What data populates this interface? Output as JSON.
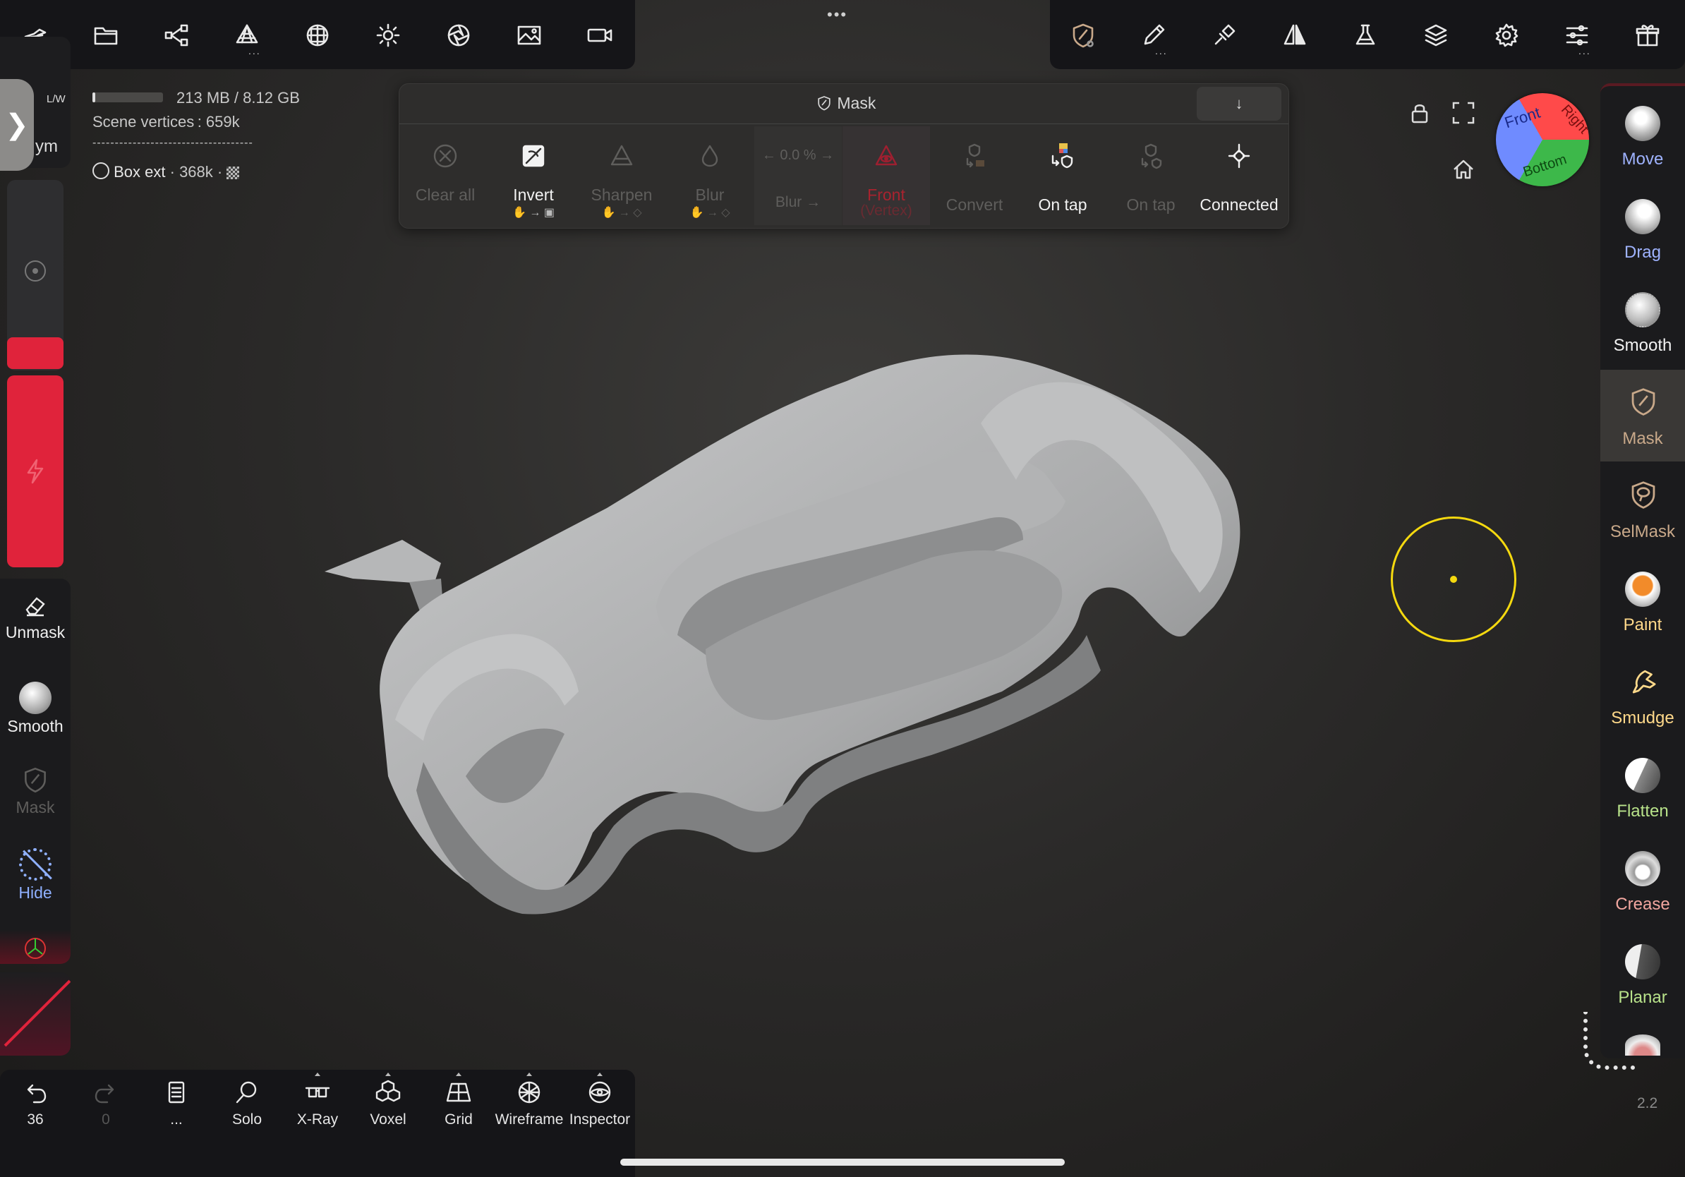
{
  "top_toolbar_left": {
    "icons": [
      "plane-icon",
      "folder-icon",
      "scene-graph-icon",
      "topology-icon",
      "material-sphere-icon",
      "light-icon",
      "camera-aperture-icon",
      "image-icon",
      "video-icon"
    ],
    "menu_dots": "•••"
  },
  "top_toolbar_right": {
    "icons": [
      "mask-tool-icon",
      "brush-pen-icon",
      "stroke-icon",
      "symmetry-icon",
      "flask-icon",
      "layers-icon",
      "settings-gear-icon",
      "sliders-icon",
      "gift-icon"
    ]
  },
  "info": {
    "memory": "213 MB / 8.12 GB",
    "scene_vertices": "Scene vertices :  659k",
    "separator": "------------------------------------",
    "object_name": "Box ext",
    "object_vertices": "· 368k ·"
  },
  "sidebar_toggle": "❯",
  "corner_label_top": "L/W",
  "corner_label_bottom": "ym",
  "mask_panel": {
    "title": "Mask",
    "collapse": "↓",
    "actions": [
      {
        "label": "Clear all",
        "enabled": false
      },
      {
        "label": "Invert",
        "enabled": true
      },
      {
        "label": "Sharpen",
        "enabled": false
      },
      {
        "label": "Blur",
        "enabled": false
      },
      {
        "label": "Blur →",
        "value": "← 0.0 % →",
        "enabled": false
      },
      {
        "label": "Front",
        "sub": "(Vertex)",
        "enabled": false
      },
      {
        "label": "Convert",
        "enabled": false
      },
      {
        "label": "On tap",
        "enabled": true
      },
      {
        "label": "On tap",
        "enabled": false
      },
      {
        "label": "Connected",
        "enabled": true
      }
    ]
  },
  "view_cube": {
    "front": "Front",
    "right": "Right",
    "bottom": "Bottom"
  },
  "right_tools": [
    {
      "label": "Move",
      "color": "#9fb3ff"
    },
    {
      "label": "Drag",
      "color": "#9fb3ff"
    },
    {
      "label": "Smooth",
      "color": "#f2f2f2"
    },
    {
      "label": "Mask",
      "color": "#c9a98a"
    },
    {
      "label": "SelMask",
      "color": "#c9a98a"
    },
    {
      "label": "Paint",
      "color": "#ffd98a"
    },
    {
      "label": "Smudge",
      "color": "#ffd98a"
    },
    {
      "label": "Flatten",
      "color": "#b8e28a"
    },
    {
      "label": "Crease",
      "color": "#f2a7a0"
    },
    {
      "label": "Planar",
      "color": "#b8e28a"
    }
  ],
  "left_tools": {
    "unmask": "Unmask",
    "smooth": "Smooth",
    "mask": "Mask",
    "hide": "Hide"
  },
  "bottom_bar": {
    "undo_count": "36",
    "redo_count": "0",
    "doc_label": "...",
    "buttons": [
      "Solo",
      "X-Ray",
      "Voxel",
      "Grid",
      "Wireframe",
      "Inspector"
    ]
  },
  "version": "2.2",
  "colors": {
    "accent_red": "#e0233b",
    "cursor_yellow": "#f5d90f",
    "mesh_gray": "#a9aaab"
  }
}
